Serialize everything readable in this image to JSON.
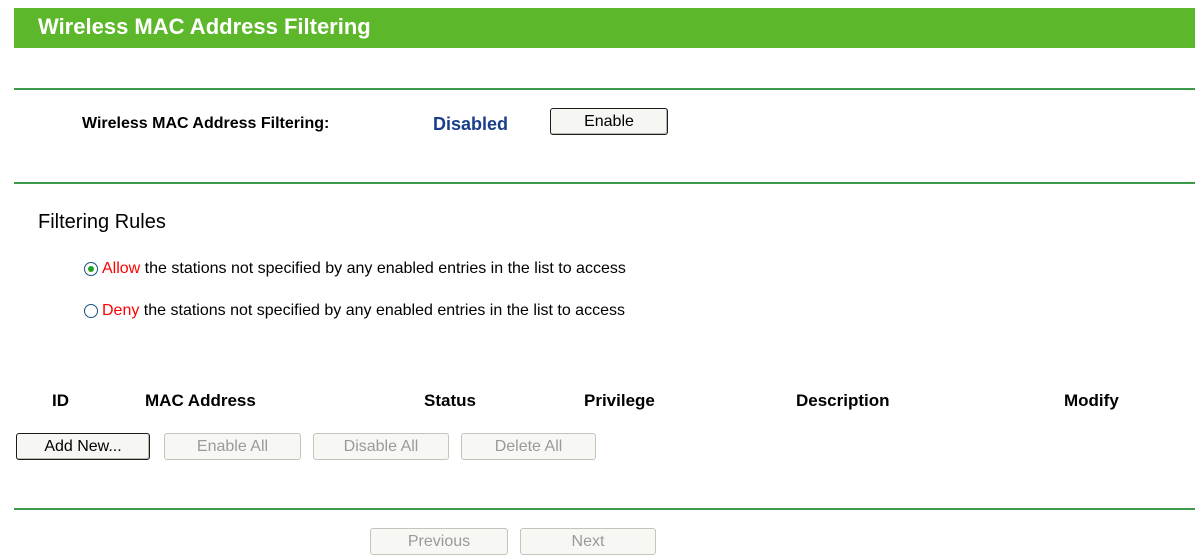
{
  "header": {
    "title": "Wireless MAC Address Filtering"
  },
  "filtering_status": {
    "label": "Wireless MAC Address Filtering:",
    "value": "Disabled",
    "enable_button": "Enable"
  },
  "rules": {
    "title": "Filtering Rules",
    "options": [
      {
        "keyword": "Allow",
        "text": " the stations not specified by any enabled entries in the list to access",
        "selected": true
      },
      {
        "keyword": "Deny",
        "text": " the stations not specified by any enabled entries in the list to access",
        "selected": false
      }
    ]
  },
  "table": {
    "columns": [
      "ID",
      "MAC Address",
      "Status",
      "Privilege",
      "Description",
      "Modify"
    ]
  },
  "actions": {
    "add_new": "Add New...",
    "enable_all": "Enable All",
    "disable_all": "Disable All",
    "delete_all": "Delete All"
  },
  "pagination": {
    "previous": "Previous",
    "next": "Next"
  },
  "colors": {
    "header_bg": "#5cb82a",
    "rule_line": "#3c9a4c",
    "status_text": "#1a3f8a",
    "keyword_red": "#ff0000"
  }
}
